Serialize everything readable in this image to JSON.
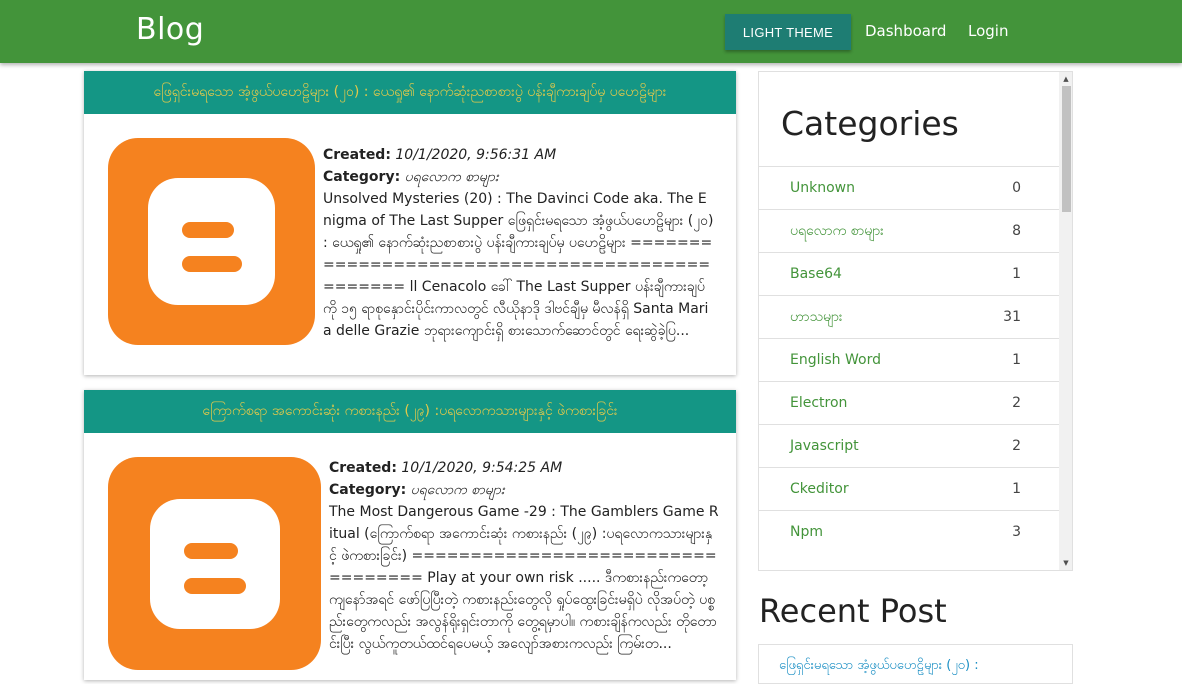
{
  "navbar": {
    "brand": "Blog",
    "theme_button": "LIGHT THEME",
    "links": [
      "Dashboard",
      "Login"
    ],
    "color": "#43943a"
  },
  "posts": [
    {
      "title": "ဖြေရှင်းမရသော အံ့ဖွယ်ပဟေဠိများ (၂၀) : ယေရှု၏ နောက်ဆုံးညစာစားပွဲ ပန်းချီကားချပ်မှ ပဟေဠိများ",
      "created_label": "Created:",
      "created": "10/1/2020, 9:56:31 AM",
      "category_label": "Category:",
      "category": "ပရလောက စာများ",
      "excerpt": "Unsolved Mysteries (20) : The Davinci Code aka. The Enigma of The Last Supper ဖြေရှင်းမရသော အံ့ဖွယ်ပဟေဠိများ (၂၀) : ယေရှု၏ နောက်ဆုံးညစာစားပွဲ ပန်းချီကားချပ်မှ ပဟေဠိများ =============================================== ll Cenacolo ခေါ် The Last Supper ပန်းချီကားချပ်ကို ၁၅ ရာစုနှောင်းပိုင်းကာလတွင် လီယိုနာဒို ဒါဗင်ချီမှ မီလန်ရှိ Santa Maria delle Grazie ဘုရားကျောင်းရှိ စားသောက်ဆောင်တွင် ရေးဆွဲခဲ့ပြ..."
    },
    {
      "title": "ကြောက်စရာ အကောင်းဆုံး ကစားနည်း (၂၉) :ပရလောကသားများနှင့် ဖဲကစားခြင်း",
      "created_label": "Created:",
      "created": "10/1/2020, 9:54:25 AM",
      "category_label": "Category:",
      "category": "ပရလောက စာများ",
      "excerpt": "The Most Dangerous Game -29 : The Gamblers Game Ritual (ကြောက်စရာ အကောင်းဆုံး ကစားနည်း (၂၉) :ပရလောကသားများနှင့် ဖဲကစားခြင်း) ================================== Play at your own risk ..... ဒီကစားနည်းကတော့ ကျနော်အရင် ဖော်ပြပြီးတဲ့ ကစားနည်းတွေလို ရှုပ်ထွေးခြင်းမရှိပဲ လိုအပ်တဲ့ ပစ္စည်းတွေကလည်း အလွန်ရိုးရှင်းတာကို တွေ့ရမှာပါ။ ကစားချိန်ကလည်း တိုတောင်းပြီး လွယ်ကူတယ်ထင်ရပေမယ့် အလျော်အစားကလည်း ကြမ်းတ..."
    }
  ],
  "categories": {
    "title": "Categories",
    "items": [
      {
        "name": "Unknown",
        "count": "0"
      },
      {
        "name": "ပရလောက စာများ",
        "count": "8"
      },
      {
        "name": "Base64",
        "count": "1"
      },
      {
        "name": "ဟာသများ",
        "count": "31"
      },
      {
        "name": "English Word",
        "count": "1"
      },
      {
        "name": "Electron",
        "count": "2"
      },
      {
        "name": "Javascript",
        "count": "2"
      },
      {
        "name": "Ckeditor",
        "count": "1"
      },
      {
        "name": "Npm",
        "count": "3"
      }
    ]
  },
  "recent": {
    "title": "Recent Post",
    "items": [
      "ဖြေရှင်းမရသော အံ့ဖွယ်ပဟေဠိများ (၂၀) :"
    ]
  },
  "colors": {
    "primary": "#43943a",
    "teal": "#149685",
    "post_title": "#e3c94a",
    "blogger_orange": "#f5821f",
    "link_blue": "#1b8fc4"
  }
}
